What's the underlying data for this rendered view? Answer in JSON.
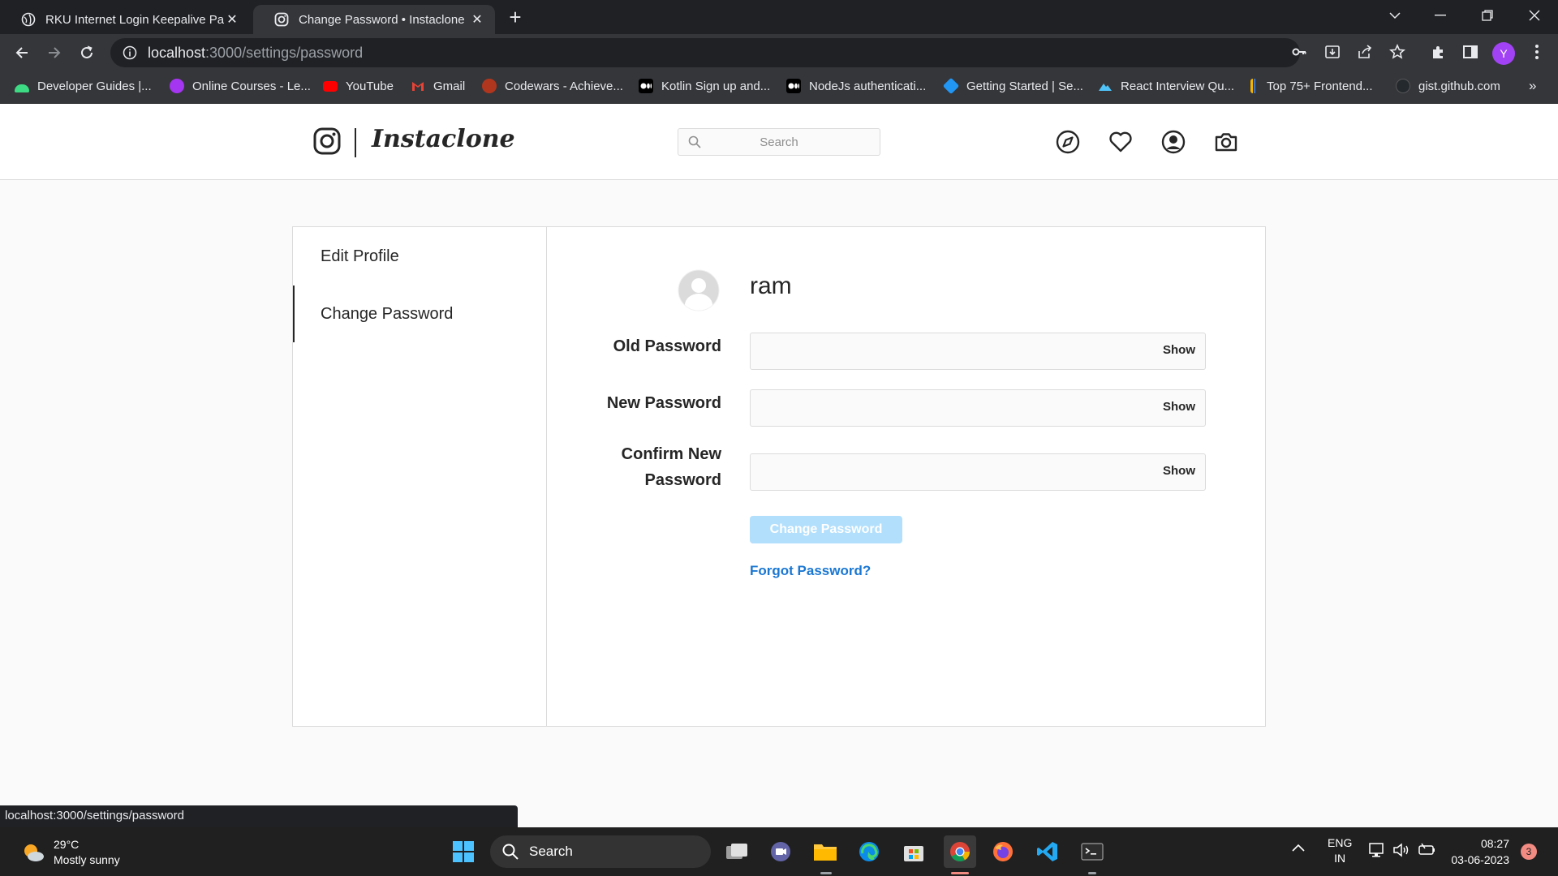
{
  "browser": {
    "tabs": [
      {
        "title": "RKU Internet Login Keepalive Page"
      },
      {
        "title": "Change Password • Instaclone"
      }
    ],
    "url_host": "localhost",
    "url_path": ":3000/settings/password",
    "profile_initial": "Y",
    "bookmarks": [
      {
        "label": "Developer Guides |...",
        "color": "#3ddc84"
      },
      {
        "label": "Online Courses - Le...",
        "color": "#a435f0"
      },
      {
        "label": "YouTube",
        "color": "#ff0000"
      },
      {
        "label": "Gmail",
        "color": "#ea4335"
      },
      {
        "label": "Codewars - Achieve...",
        "color": "#b1361e"
      },
      {
        "label": "Kotlin Sign up and...",
        "color": "#ffffff"
      },
      {
        "label": "NodeJs authenticati...",
        "color": "#ffffff"
      },
      {
        "label": "Getting Started | Se...",
        "color": "#2196f3"
      },
      {
        "label": "React Interview Qu...",
        "color": "#4fc3f7"
      },
      {
        "label": "Top 75+ Frontend...",
        "color": "#f4b400"
      },
      {
        "label": "gist.github.com",
        "color": "#24292e"
      }
    ],
    "status_url": "localhost:3000/settings/password"
  },
  "app": {
    "logo_text": "Instaclone",
    "search_placeholder": "Search"
  },
  "settings": {
    "sidebar": [
      {
        "label": "Edit Profile"
      },
      {
        "label": "Change Password"
      }
    ],
    "username": "ram",
    "fields": [
      {
        "label": "Old Password",
        "show": "Show"
      },
      {
        "label": "New Password",
        "show": "Show"
      },
      {
        "label_line1": "Confirm New",
        "label_line2": "Password",
        "show": "Show"
      }
    ],
    "submit_label": "Change Password",
    "forgot_label": "Forgot Password?"
  },
  "taskbar": {
    "temperature": "29°C",
    "weather": "Mostly sunny",
    "search_label": "Search",
    "lang1": "ENG",
    "lang2": "IN",
    "time": "08:27",
    "date": "03-06-2023",
    "notifications": "3"
  },
  "colors": {
    "button_disabled": "#b2dffc",
    "link": "#1a77d2",
    "border": "#dbdbdb"
  }
}
